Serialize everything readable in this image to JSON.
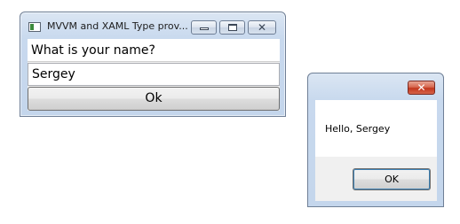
{
  "main_window": {
    "title": "MVVM and XAML Type prov...",
    "question": "What is your name?",
    "name_value": "Sergey",
    "ok_label": "Ok",
    "controls": {
      "minimize_icon": "minimize-icon",
      "maximize_icon": "maximize-icon",
      "close_icon": "close-icon",
      "close_glyph": "✕"
    }
  },
  "message_box": {
    "message": "Hello, Sergey",
    "ok_label": "OK",
    "close_icon": "close-icon",
    "close_glyph": "✕",
    "close_color": "#c2371d"
  },
  "colors": {
    "titlebar": "#c8d9ee",
    "client": "#f0f0f0",
    "border": "#6f7f96"
  }
}
